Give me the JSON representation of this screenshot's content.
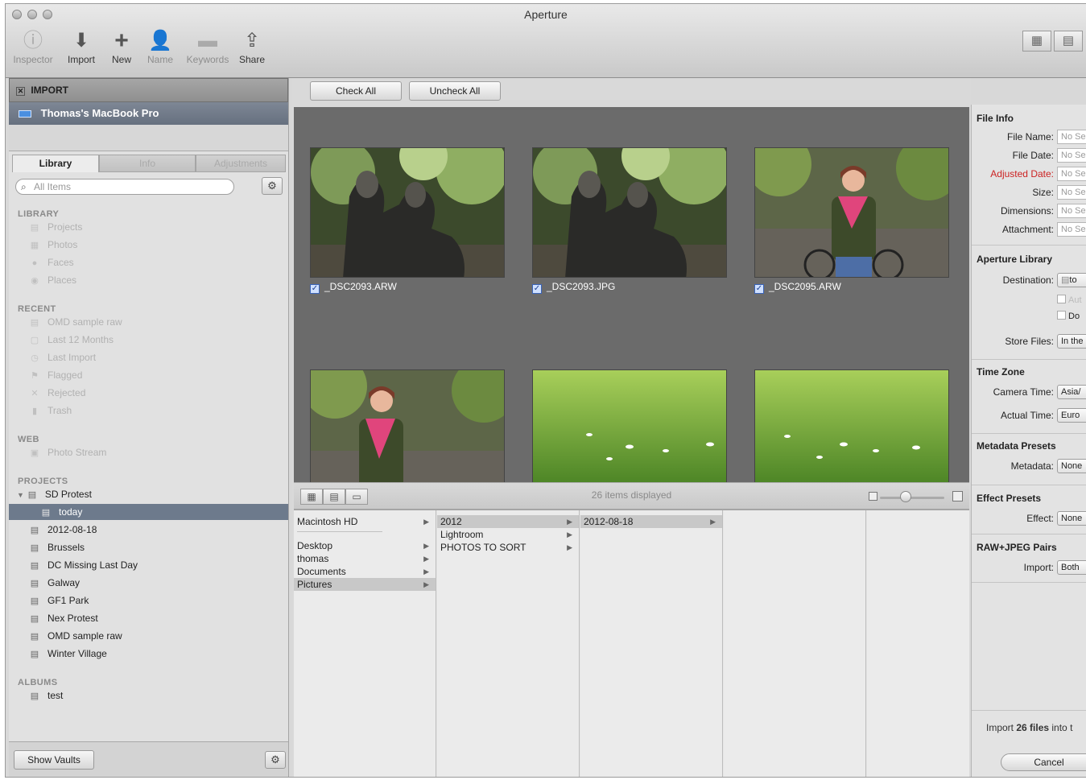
{
  "window": {
    "title": "Aperture"
  },
  "toolbar": {
    "items": [
      {
        "label": "Inspector",
        "icon": "info-icon",
        "enabled": false
      },
      {
        "label": "Import",
        "icon": "import-arrow-icon",
        "enabled": true
      },
      {
        "label": "New",
        "icon": "plus-icon",
        "enabled": true
      },
      {
        "label": "Name",
        "icon": "person-icon",
        "enabled": false
      },
      {
        "label": "Keywords",
        "icon": "tag-icon",
        "enabled": false
      },
      {
        "label": "Share",
        "icon": "share-icon",
        "enabled": true
      }
    ],
    "view_switch": [
      "grid-view-icon",
      "single-view-icon"
    ]
  },
  "import_panel": {
    "title": "IMPORT",
    "device": "Thomas's MacBook Pro"
  },
  "tabs": [
    "Library",
    "Info",
    "Adjustments"
  ],
  "search": {
    "placeholder": "All Items"
  },
  "library": {
    "sections": {
      "library": "LIBRARY",
      "recent": "RECENT",
      "web": "WEB",
      "projects": "PROJECTS",
      "albums": "ALBUMS"
    },
    "library_items": [
      "Projects",
      "Photos",
      "Faces",
      "Places"
    ],
    "recent_items": [
      "OMD sample raw",
      "Last 12 Months",
      "Last Import",
      "Flagged",
      "Rejected",
      "Trash"
    ],
    "web_items": [
      "Photo Stream"
    ],
    "project_items": [
      "SD Protest",
      "today",
      "2012-08-18",
      "Brussels",
      "DC Missing Last Day",
      "Galway",
      "GF1 Park",
      "Nex Protest",
      "OMD sample raw",
      "Winter Village"
    ],
    "album_items": [
      "test"
    ],
    "show_vaults": "Show Vaults"
  },
  "main": {
    "check_all": "Check All",
    "uncheck_all": "Uncheck All",
    "thumbnails": [
      {
        "filename": "_DSC2093.ARW",
        "checked": true,
        "subject": "statue"
      },
      {
        "filename": "_DSC2093.JPG",
        "checked": true,
        "subject": "statue"
      },
      {
        "filename": "_DSC2095.ARW",
        "checked": true,
        "subject": "portrait"
      },
      {
        "filename": "",
        "checked": false,
        "subject": "portrait"
      },
      {
        "filename": "",
        "checked": false,
        "subject": "grass"
      },
      {
        "filename": "",
        "checked": false,
        "subject": "grass"
      }
    ],
    "items_displayed": "26 items displayed",
    "zoom_level": 0.4
  },
  "browser": {
    "col1": [
      "Macintosh HD",
      "Desktop",
      "thomas",
      "Documents",
      "Pictures"
    ],
    "col2": [
      "2012",
      "Lightroom",
      "PHOTOS TO SORT"
    ],
    "col3": [
      "2012-08-18"
    ]
  },
  "inspector": {
    "file_info": {
      "title": "File Info",
      "labels": [
        "File Name:",
        "File Date:",
        "Adjusted Date:",
        "Size:",
        "Dimensions:",
        "Attachment:"
      ],
      "value": "No Se"
    },
    "aperture_library": {
      "title": "Aperture Library",
      "destination_label": "Destination:",
      "destination_value": "to",
      "check1": "Aut",
      "check2": "Do",
      "store_files_label": "Store Files:",
      "store_files_value": "In the"
    },
    "time_zone": {
      "title": "Time Zone",
      "camera_label": "Camera Time:",
      "camera_value": "Asia/",
      "actual_label": "Actual Time:",
      "actual_value": "Euro"
    },
    "metadata_presets": {
      "title": "Metadata Presets",
      "label": "Metadata:",
      "value": "None"
    },
    "effect_presets": {
      "title": "Effect Presets",
      "label": "Effect:",
      "value": "None"
    },
    "raw_jpeg": {
      "title": "RAW+JPEG Pairs",
      "label": "Import:",
      "value": "Both"
    },
    "import_prefix": "Import ",
    "import_count": "26 files",
    "import_suffix": " into t",
    "cancel": "Cancel"
  }
}
